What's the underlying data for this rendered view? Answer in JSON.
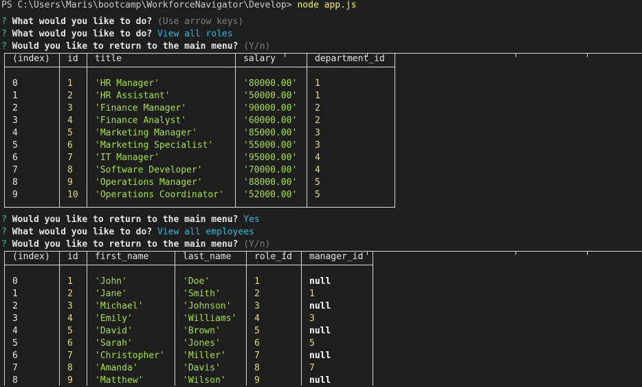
{
  "command": {
    "prompt": "PS C:\\Users\\Maris\\bootcamp\\WorkforceNavigator\\Develop> ",
    "cmd": "node app.js"
  },
  "prompt_marker": "?",
  "session1": {
    "q1": "What would you like to do?",
    "q1_hint": "(Use arrow keys)",
    "q2": "What would you like to do?",
    "q2_answer": "View all roles",
    "q3": "Would you like to return to the main menu?",
    "q3_hint": "(Y/n)"
  },
  "roles_table": {
    "headers": [
      "(index)",
      "id",
      "title",
      "salary",
      "department_id"
    ],
    "rows": [
      [
        "0",
        "1",
        "'HR Manager'",
        "'80000.00'",
        "1"
      ],
      [
        "1",
        "2",
        "'HR Assistant'",
        "'50000.00'",
        "1"
      ],
      [
        "2",
        "3",
        "'Finance Manager'",
        "'90000.00'",
        "2"
      ],
      [
        "3",
        "4",
        "'Finance Analyst'",
        "'60000.00'",
        "2"
      ],
      [
        "4",
        "5",
        "'Marketing Manager'",
        "'85000.00'",
        "3"
      ],
      [
        "5",
        "6",
        "'Marketing Specialist'",
        "'55000.00'",
        "3"
      ],
      [
        "6",
        "7",
        "'IT Manager'",
        "'95000.00'",
        "4"
      ],
      [
        "7",
        "8",
        "'Software Developer'",
        "'70000.00'",
        "4"
      ],
      [
        "8",
        "9",
        "'Operations Manager'",
        "'88000.00'",
        "5"
      ],
      [
        "9",
        "10",
        "'Operations Coordinator'",
        "'52000.00'",
        "5"
      ]
    ]
  },
  "session2": {
    "q1": "Would you like to return to the main menu?",
    "q1_answer": "Yes",
    "q2": "What would you like to do?",
    "q2_answer": "View all employees",
    "q3": "Would you like to return to the main menu?",
    "q3_hint": "(Y/n)"
  },
  "employees_table": {
    "headers": [
      "(index)",
      "id",
      "first_name",
      "last_name",
      "role_id",
      "manager_id"
    ],
    "rows": [
      [
        "0",
        "1",
        "'John'",
        "'Doe'",
        "1",
        "null"
      ],
      [
        "1",
        "2",
        "'Jane'",
        "'Smith'",
        "2",
        "1"
      ],
      [
        "2",
        "3",
        "'Michael'",
        "'Johnson'",
        "3",
        "null"
      ],
      [
        "3",
        "4",
        "'Emily'",
        "'Williams'",
        "4",
        "3"
      ],
      [
        "4",
        "5",
        "'David'",
        "'Brown'",
        "5",
        "null"
      ],
      [
        "5",
        "6",
        "'Sarah'",
        "'Jones'",
        "6",
        "5"
      ],
      [
        "6",
        "7",
        "'Christopher'",
        "'Miller'",
        "7",
        "null"
      ],
      [
        "7",
        "8",
        "'Amanda'",
        "'Davis'",
        "8",
        "7"
      ],
      [
        "8",
        "9",
        "'Matthew'",
        "'Wilson'",
        "9",
        "null"
      ]
    ]
  },
  "colors": {
    "background": "#1e1e1e",
    "prompt_marker": "#23d18b",
    "answer": "#29b8db",
    "hint": "#7f7f7f",
    "string_value": "#a6e22e",
    "number_value": "#e6db74",
    "command": "#f5f543"
  }
}
